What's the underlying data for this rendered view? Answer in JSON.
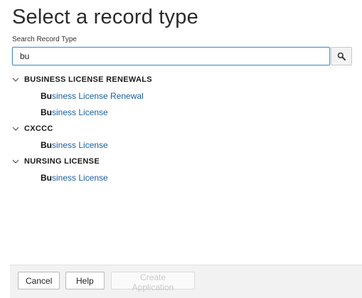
{
  "page": {
    "title": "Select a record type"
  },
  "search": {
    "label": "Search Record Type",
    "value": "bu"
  },
  "groups": [
    {
      "label": "BUSINESS LICENSE RENEWALS",
      "expanded": true,
      "items": [
        {
          "match": "Bu",
          "rest": "siness License Renewal"
        },
        {
          "match": "Bu",
          "rest": "siness License"
        }
      ]
    },
    {
      "label": "CXCCC",
      "expanded": true,
      "items": [
        {
          "match": "Bu",
          "rest": "siness License"
        }
      ]
    },
    {
      "label": "NURSING LICENSE",
      "expanded": true,
      "items": [
        {
          "match": "Bu",
          "rest": "siness License"
        }
      ]
    }
  ],
  "footer": {
    "cancel_label": "Cancel",
    "help_label": "Help",
    "create_label": "Create Application"
  },
  "icons": {
    "search": "search-icon",
    "chevron": "chevron-down-icon"
  },
  "colors": {
    "link": "#1a5fa8",
    "input_focus_border": "#4a90c8",
    "footer_bg": "#f2f2f2"
  }
}
